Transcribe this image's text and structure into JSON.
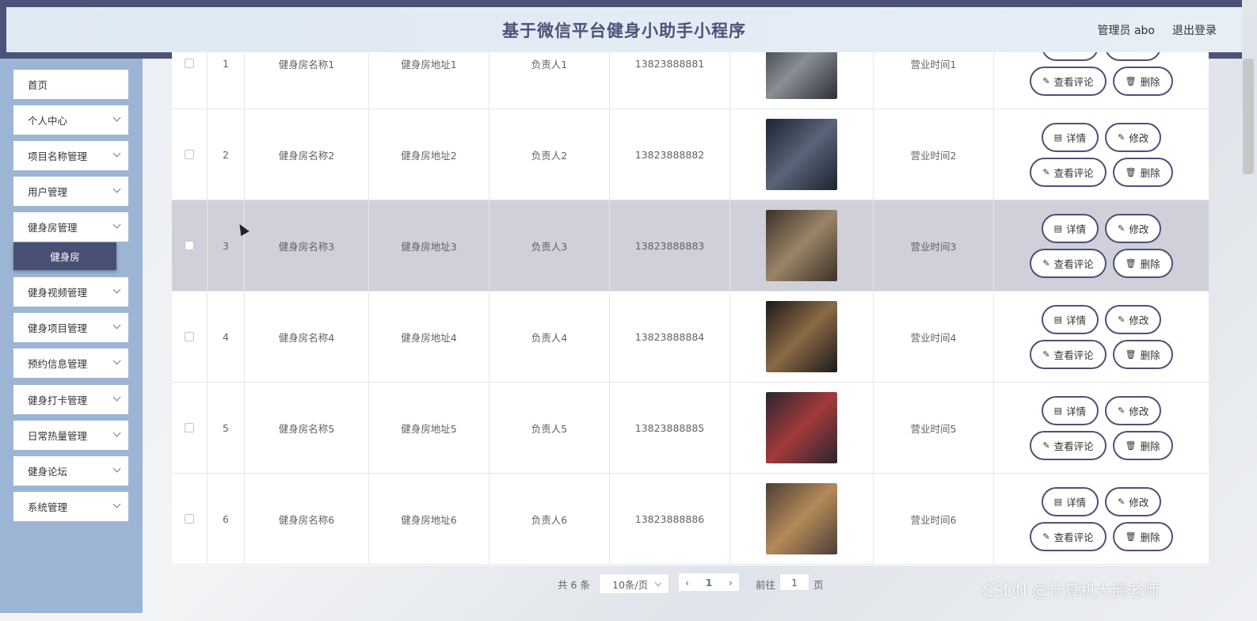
{
  "header": {
    "title": "基于微信平台健身小助手小程序",
    "user_label": "管理员 abo",
    "logout_label": "退出登录"
  },
  "sidebar": {
    "items": [
      {
        "label": "首页",
        "has_children": false
      },
      {
        "label": "个人中心",
        "has_children": true
      },
      {
        "label": "项目名称管理",
        "has_children": true
      },
      {
        "label": "用户管理",
        "has_children": true
      },
      {
        "label": "健身房管理",
        "has_children": true
      },
      {
        "label": "健身视频管理",
        "has_children": true
      },
      {
        "label": "健身项目管理",
        "has_children": true
      },
      {
        "label": "预约信息管理",
        "has_children": true
      },
      {
        "label": "健身打卡管理",
        "has_children": true
      },
      {
        "label": "日常热量管理",
        "has_children": true
      },
      {
        "label": "健身论坛",
        "has_children": true
      },
      {
        "label": "系统管理",
        "has_children": true
      }
    ],
    "active_submenu": "健身房"
  },
  "table": {
    "actions": {
      "detail": "详情",
      "edit": "修改",
      "comments": "查看评论",
      "delete": "删除"
    },
    "rows": [
      {
        "index": "1",
        "name": "健身房名称1",
        "address": "健身房地址1",
        "manager": "负责人1",
        "phone": "13823888881",
        "hours": "营业时间1",
        "img_colors": [
          "#2b2f36",
          "#8a8f96"
        ]
      },
      {
        "index": "2",
        "name": "健身房名称2",
        "address": "健身房地址2",
        "manager": "负责人2",
        "phone": "13823888882",
        "hours": "营业时间2",
        "img_colors": [
          "#1c2433",
          "#5a6478"
        ]
      },
      {
        "index": "3",
        "name": "健身房名称3",
        "address": "健身房地址3",
        "manager": "负责人3",
        "phone": "13823888883",
        "hours": "营业时间3",
        "img_colors": [
          "#3b3128",
          "#9a8468"
        ]
      },
      {
        "index": "4",
        "name": "健身房名称4",
        "address": "健身房地址4",
        "manager": "负责人4",
        "phone": "13823888884",
        "hours": "营业时间4",
        "img_colors": [
          "#1b1a1c",
          "#8a6a44"
        ]
      },
      {
        "index": "5",
        "name": "健身房名称5",
        "address": "健身房地址5",
        "manager": "负责人5",
        "phone": "13823888885",
        "hours": "营业时间5",
        "img_colors": [
          "#2a2530",
          "#a33a3a"
        ]
      },
      {
        "index": "6",
        "name": "健身房名称6",
        "address": "健身房地址6",
        "manager": "负责人6",
        "phone": "13823888886",
        "hours": "营业时间6",
        "img_colors": [
          "#4a3f36",
          "#b58a5a"
        ]
      }
    ],
    "highlighted_row": "3"
  },
  "pagination": {
    "total": "共 6 条",
    "page_size": "10条/页",
    "current_page": "1",
    "goto_label": "前往",
    "goto_value": "1",
    "goto_suffix": "页"
  },
  "watermark": "CSDN @计算机大鹅老师"
}
